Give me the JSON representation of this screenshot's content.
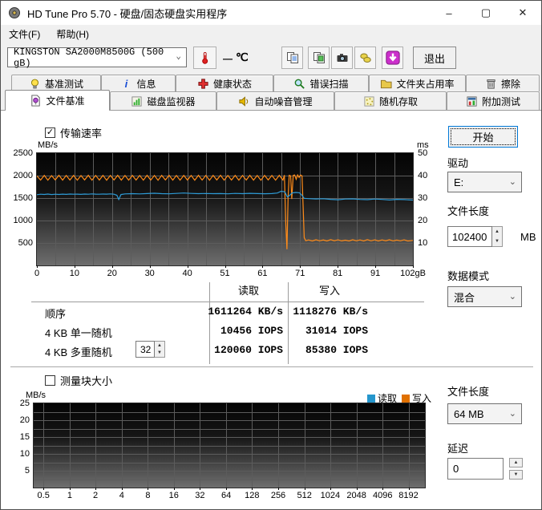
{
  "window": {
    "title": "HD Tune Pro 5.70 - 硬盘/固态硬盘实用程序"
  },
  "glyphs": {
    "check": "✓",
    "chevron": "⌄",
    "spin_up": "▲",
    "spin_down": "▼",
    "minimize": "–",
    "maximize": "▢",
    "close": "✕"
  },
  "menu": {
    "file": "文件(F)",
    "help": "帮助(H)"
  },
  "toolbar": {
    "drive_select": "KINGSTON SA2000M8500G (500 gB)",
    "temp_dash": "—",
    "temp_unit": "℃",
    "exit_label": "退出"
  },
  "tabs": {
    "row1": [
      {
        "label": "基准测试"
      },
      {
        "label": "信息"
      },
      {
        "label": "健康状态"
      },
      {
        "label": "错误扫描"
      },
      {
        "label": "文件夹占用率"
      },
      {
        "label": "擦除"
      }
    ],
    "row2": [
      {
        "label": "文件基准",
        "selected": true
      },
      {
        "label": "磁盘监视器"
      },
      {
        "label": "自动噪音管理"
      },
      {
        "label": "随机存取"
      },
      {
        "label": "附加测试"
      }
    ]
  },
  "benchmark": {
    "transfer_checkbox": "传输速率",
    "transfer_checked": true,
    "block_checkbox": "测量块大小",
    "block_checked": false,
    "legend": {
      "read": "读取",
      "write": "写入",
      "read_color": "#2596cc",
      "write_color": "#e07000"
    },
    "table": {
      "col_read": "读取",
      "col_write": "写入",
      "rows": [
        {
          "label": "顺序",
          "read": "1611264 KB/s",
          "write": "1118276 KB/s"
        },
        {
          "label": "4 KB 单一随机",
          "read": "10456 IOPS",
          "write": "31014 IOPS"
        },
        {
          "label": "4 KB 多重随机",
          "queue_depth": "32",
          "read": "120060 IOPS",
          "write": "85380 IOPS"
        }
      ]
    }
  },
  "controls": {
    "start": "开始",
    "drive_label": "驱动",
    "drive_value": "E:",
    "file_length_label": "文件长度",
    "file_length_value": "102400",
    "file_length_unit": "MB",
    "data_mode_label": "数据模式",
    "data_mode_value": "混合",
    "block_file_length_label": "文件长度",
    "block_file_length_value": "64 MB",
    "delay_label": "延迟",
    "delay_value": "0"
  },
  "chart_data": [
    {
      "id": "transfer",
      "type": "line",
      "title": "传输速率",
      "ylabel_left": "MB/s",
      "ylabel_right": "ms",
      "xlabel_unit": "gB",
      "x_min": 0,
      "x_max": 102.4,
      "y_min": 0,
      "y_max": 2500,
      "x_ticks": [
        "0",
        "10",
        "20",
        "30",
        "40",
        "51",
        "61",
        "71",
        "81",
        "91",
        "102gB"
      ],
      "y_ticks_left": [
        "2500",
        "2000",
        "1500",
        "1000",
        "500"
      ],
      "y_ticks_right": [
        "50",
        "40",
        "30",
        "20",
        "10"
      ],
      "layout": {
        "grid_color": "#5c5c5c",
        "x_tick_fracs": [
          0,
          0.1,
          0.2,
          0.3,
          0.4,
          0.5,
          0.6,
          0.7,
          0.8,
          0.9,
          1
        ],
        "y_tick_fracs": [
          0,
          0.2,
          0.4,
          0.6,
          0.8
        ],
        "h_grid": [
          0.2,
          0.4,
          0.6,
          0.8
        ],
        "v_grid": [
          0.05,
          0.1,
          0.15,
          0.2,
          0.25,
          0.3,
          0.35,
          0.4,
          0.45,
          0.5,
          0.55,
          0.6,
          0.65,
          0.7,
          0.75,
          0.8,
          0.85,
          0.9,
          0.95
        ],
        "legend_position": "none"
      },
      "series": [
        {
          "name": "写入",
          "color": "#ff8c1a",
          "points": [
            [
              0,
              1995
            ],
            [
              1,
              1900
            ],
            [
              2,
              2005
            ],
            [
              3,
              1898
            ],
            [
              4,
              2000
            ],
            [
              5,
              1905
            ],
            [
              6,
              2008
            ],
            [
              7,
              1900
            ],
            [
              8,
              2003
            ],
            [
              9,
              1902
            ],
            [
              10,
              2006
            ],
            [
              11,
              1898
            ],
            [
              12,
              2002
            ],
            [
              13,
              1904
            ],
            [
              14,
              2007
            ],
            [
              15,
              1899
            ],
            [
              16,
              2004
            ],
            [
              17,
              1901
            ],
            [
              18,
              2006
            ],
            [
              19,
              1897
            ],
            [
              20,
              2003
            ],
            [
              21,
              1903
            ],
            [
              22,
              2007
            ],
            [
              23,
              1900
            ],
            [
              24,
              2004
            ],
            [
              25,
              1898
            ],
            [
              26,
              2006
            ],
            [
              27,
              1902
            ],
            [
              28,
              2003
            ],
            [
              29,
              1899
            ],
            [
              30,
              2007
            ],
            [
              31,
              1901
            ],
            [
              32,
              2004
            ],
            [
              33,
              1897
            ],
            [
              34,
              2005
            ],
            [
              35,
              1903
            ],
            [
              36,
              2008
            ],
            [
              37,
              1900
            ],
            [
              38,
              2003
            ],
            [
              39,
              1898
            ],
            [
              40,
              2006
            ],
            [
              41,
              1902
            ],
            [
              42,
              2004
            ],
            [
              43,
              1899
            ],
            [
              44,
              2007
            ],
            [
              45,
              1901
            ],
            [
              46,
              2003
            ],
            [
              47,
              1897
            ],
            [
              48,
              2005
            ],
            [
              49,
              1903
            ],
            [
              50,
              2008
            ],
            [
              51,
              1899
            ],
            [
              52,
              2004
            ],
            [
              53,
              1901
            ],
            [
              54,
              2006
            ],
            [
              55,
              1898
            ],
            [
              56,
              2003
            ],
            [
              57,
              1902
            ],
            [
              58,
              2007
            ],
            [
              59,
              1900
            ],
            [
              60,
              2004
            ],
            [
              61,
              1897
            ],
            [
              62,
              2006
            ],
            [
              63,
              1903
            ],
            [
              64,
              2003
            ],
            [
              65,
              1899
            ],
            [
              66,
              2008
            ],
            [
              67,
              1900
            ],
            [
              67.4,
              2010
            ],
            [
              67.8,
              900
            ],
            [
              68.1,
              360
            ],
            [
              68.4,
              1500
            ],
            [
              68.7,
              2005
            ],
            [
              69.1,
              1995
            ],
            [
              69.4,
              1480
            ],
            [
              69.8,
              2005
            ],
            [
              70.2,
              2015
            ],
            [
              70.6,
              1920
            ],
            [
              71,
              2015
            ],
            [
              71.4,
              1960
            ],
            [
              71.8,
              2012
            ],
            [
              72.2,
              1995
            ],
            [
              72.5,
              1300
            ],
            [
              72.8,
              620
            ],
            [
              73.2,
              550
            ],
            [
              74,
              568
            ],
            [
              75,
              545
            ],
            [
              76,
              572
            ],
            [
              77,
              548
            ],
            [
              78,
              566
            ],
            [
              79,
              544
            ],
            [
              80,
              574
            ],
            [
              81,
              550
            ],
            [
              82,
              569
            ],
            [
              83,
              546
            ],
            [
              84,
              563
            ],
            [
              85,
              544
            ],
            [
              86,
              571
            ],
            [
              87,
              549
            ],
            [
              88,
              567
            ],
            [
              89,
              545
            ],
            [
              90,
              574
            ],
            [
              91,
              548
            ],
            [
              92,
              570
            ],
            [
              93,
              545
            ],
            [
              94,
              567
            ],
            [
              95,
              550
            ],
            [
              96,
              571
            ],
            [
              97,
              546
            ],
            [
              98,
              564
            ],
            [
              99,
              548
            ],
            [
              100,
              569
            ],
            [
              101,
              545
            ],
            [
              102.4,
              558
            ]
          ]
        },
        {
          "name": "读取",
          "color": "#2e9bd6",
          "points": [
            [
              0,
              1575
            ],
            [
              1,
              1585
            ],
            [
              2,
              1580
            ],
            [
              3,
              1590
            ],
            [
              4,
              1578
            ],
            [
              5,
              1585
            ],
            [
              6,
              1580
            ],
            [
              7,
              1588
            ],
            [
              8,
              1582
            ],
            [
              9,
              1590
            ],
            [
              10,
              1585
            ],
            [
              11,
              1588
            ],
            [
              12,
              1582
            ],
            [
              13,
              1590
            ],
            [
              14,
              1585
            ],
            [
              15,
              1592
            ],
            [
              16,
              1588
            ],
            [
              17,
              1585
            ],
            [
              18,
              1590
            ],
            [
              19,
              1588
            ],
            [
              20,
              1592
            ],
            [
              21,
              1585
            ],
            [
              21.8,
              1562
            ],
            [
              22.3,
              1468
            ],
            [
              22.9,
              1578
            ],
            [
              24,
              1592
            ],
            [
              26,
              1598
            ],
            [
              28,
              1592
            ],
            [
              30,
              1600
            ],
            [
              32,
              1608
            ],
            [
              34,
              1598
            ],
            [
              36,
              1595
            ],
            [
              38,
              1604
            ],
            [
              40,
              1612
            ],
            [
              42,
              1604
            ],
            [
              44,
              1598
            ],
            [
              46,
              1602
            ],
            [
              48,
              1598
            ],
            [
              50,
              1600
            ],
            [
              52,
              1595
            ],
            [
              54,
              1603
            ],
            [
              56,
              1598
            ],
            [
              58,
              1605
            ],
            [
              60,
              1600
            ],
            [
              62,
              1596
            ],
            [
              64,
              1600
            ],
            [
              65.5,
              1612
            ],
            [
              66.5,
              1652
            ],
            [
              67.5,
              1640
            ],
            [
              68.2,
              1525
            ],
            [
              68.8,
              1558
            ],
            [
              69.5,
              1615
            ],
            [
              70.5,
              1625
            ],
            [
              71.5,
              1618
            ],
            [
              72.2,
              1560
            ],
            [
              72.8,
              1495
            ],
            [
              74,
              1488
            ],
            [
              76,
              1480
            ],
            [
              78,
              1486
            ],
            [
              80,
              1472
            ],
            [
              82,
              1462
            ],
            [
              84,
              1478
            ],
            [
              86,
              1482
            ],
            [
              88,
              1470
            ],
            [
              90,
              1465
            ],
            [
              92,
              1478
            ],
            [
              94,
              1470
            ],
            [
              96,
              1458
            ],
            [
              98,
              1472
            ],
            [
              100,
              1466
            ],
            [
              102.4,
              1456
            ]
          ]
        }
      ]
    },
    {
      "id": "blocksize",
      "type": "line",
      "title": "测量块大小",
      "ylabel_left": "MB/s",
      "x_min": 0,
      "x_max": 15,
      "y_min": 0,
      "y_max": 25,
      "x_ticks": [
        "0.5",
        "1",
        "2",
        "4",
        "8",
        "16",
        "32",
        "64",
        "128",
        "256",
        "512",
        "1024",
        "2048",
        "4096",
        "8192"
      ],
      "y_ticks_left": [
        "25",
        "20",
        "15",
        "10",
        "5"
      ],
      "layout": {
        "grid_color": "#5c5c5c",
        "x_tick_fracs": [
          0.025,
          0.092,
          0.158,
          0.225,
          0.292,
          0.358,
          0.425,
          0.492,
          0.558,
          0.625,
          0.692,
          0.758,
          0.825,
          0.892,
          0.958
        ],
        "y_tick_fracs": [
          0,
          0.2,
          0.4,
          0.6,
          0.8
        ],
        "h_grid": [
          0.1,
          0.2,
          0.3,
          0.4,
          0.5,
          0.6,
          0.7,
          0.8,
          0.9
        ],
        "v_grid": [
          0.025,
          0.092,
          0.158,
          0.225,
          0.292,
          0.358,
          0.425,
          0.492,
          0.558,
          0.625,
          0.692,
          0.758,
          0.825,
          0.892,
          0.958
        ],
        "legend_position": "top-right"
      },
      "series": [
        {
          "name": "读取",
          "color": "#2e9bd6",
          "points": []
        },
        {
          "name": "写入",
          "color": "#e07000",
          "points": []
        }
      ]
    }
  ]
}
